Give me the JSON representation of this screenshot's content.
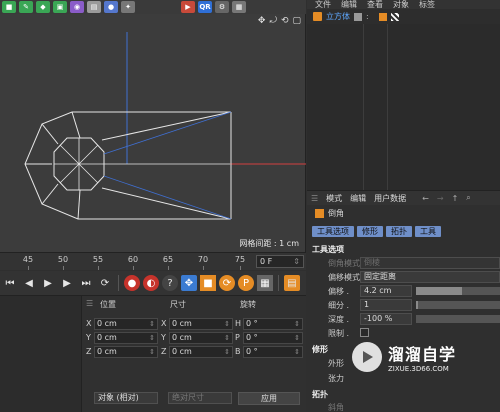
{
  "top_toolbar": {
    "icons": [
      "cube-icon",
      "pen-icon",
      "subdivision-icon",
      "array-icon",
      "deformer-icon",
      "scene-icon",
      "camera-icon",
      "light-icon"
    ],
    "qr_label": "QR"
  },
  "viewport": {
    "grid_status": "网格间距 : 1 cm",
    "nav_icons": [
      "move-view-icon",
      "rotate-view-icon",
      "zoom-view-icon",
      "maximize-view-icon"
    ],
    "colors": {
      "background": "#3c3c3c",
      "mesh": "#e6e6e6",
      "y_axis": "#3f6fd1",
      "x_axis": "#d24040"
    }
  },
  "timeline": {
    "ticks": [
      "45",
      "50",
      "55",
      "60",
      "65",
      "70",
      "75"
    ],
    "frame_field": "0 F"
  },
  "transport": {
    "buttons": [
      "go-start",
      "prev-frame",
      "play",
      "next-frame",
      "go-end",
      "record-icon",
      "auto-key-icon",
      "move-key-icon",
      "scale-key-icon",
      "rotate-key-icon",
      "param-key-icon",
      "pla-key-icon",
      "timeline-icon"
    ]
  },
  "coordinates": {
    "headers": {
      "position": "位置",
      "size": "尺寸",
      "rotation": "旋转"
    },
    "rows": [
      {
        "axis_pos": "X",
        "pos": "0 cm",
        "axis_size": "X",
        "size": "0 cm",
        "axis_rot": "H",
        "rot": "0 °"
      },
      {
        "axis_pos": "Y",
        "pos": "0 cm",
        "axis_size": "Y",
        "size": "0 cm",
        "axis_rot": "P",
        "rot": "0 °"
      },
      {
        "axis_pos": "Z",
        "pos": "0 cm",
        "axis_size": "Z",
        "size": "0 cm",
        "axis_rot": "B",
        "rot": "0 °"
      }
    ],
    "mode_dropdown": "对象 (相对)",
    "size_dropdown": "绝对尺寸",
    "apply_label": "应用"
  },
  "object_manager": {
    "menu": [
      "文件",
      "编辑",
      "查看",
      "对象",
      "标签"
    ],
    "object_name": "立方体"
  },
  "attribute_manager": {
    "menu": [
      "模式",
      "编辑",
      "用户数据"
    ],
    "tool_name": "倒角",
    "tabs": [
      "工具选项",
      "修形",
      "拓扑",
      "工具"
    ],
    "section_tool_options": "工具选项",
    "rows": {
      "bevel_mode_label": "倒角模式",
      "bevel_mode_value": "倒棱",
      "offset_mode_label": "偏移模式",
      "offset_mode_value": "固定距离",
      "offset_label": "偏移 .",
      "offset_value": "4.2 cm",
      "offset_fill": 0.55,
      "subdiv_label": "细分 .",
      "subdiv_value": "1",
      "subdiv_fill": 0.02,
      "depth_label": "深度 .",
      "depth_value": "-100 %",
      "depth_fill": 0.0,
      "limit_label": "限制 ."
    },
    "section_shaping": "修形",
    "shape_label": "外形",
    "tension_label": "张力",
    "section_topology": "拓扑",
    "corner_label": "斜角"
  },
  "watermark": {
    "title": "溜溜自学",
    "url": "ZIXUE.3D66.COM"
  }
}
